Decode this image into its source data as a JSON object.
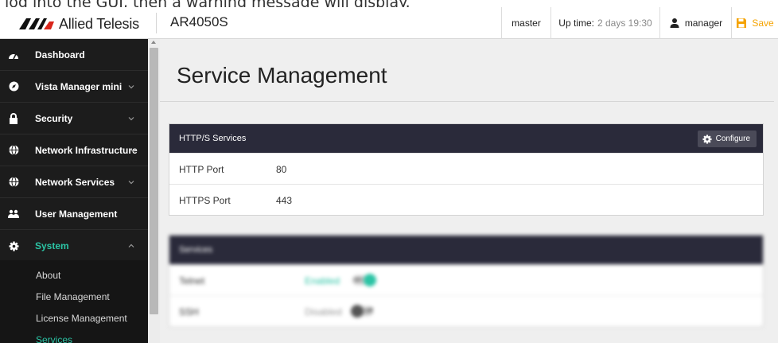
{
  "caption": {
    "text": "log into the GUI, then a warning message will display."
  },
  "header": {
    "brand": "Allied Telesis",
    "model": "AR4050S",
    "master": "master",
    "uptime_label": "Up time:",
    "uptime_value": "2 days 19:30",
    "user": "manager",
    "save": "Save",
    "save_color": "#f5a300"
  },
  "sidebar": {
    "items": [
      {
        "label": "Dashboard",
        "icon": "dashboard-icon"
      },
      {
        "label": "Vista Manager mini",
        "icon": "compass-icon"
      },
      {
        "label": "Security",
        "icon": "lock-icon"
      },
      {
        "label": "Network Infrastructure",
        "icon": "globe-icon"
      },
      {
        "label": "Network Services",
        "icon": "globe-icon"
      },
      {
        "label": "User Management",
        "icon": "users-icon"
      },
      {
        "label": "System",
        "icon": "gear-icon"
      }
    ],
    "submenu": [
      "About",
      "File Management",
      "License Management",
      "Services"
    ],
    "accent_color": "#2bc4a5"
  },
  "main": {
    "title": "Service Management",
    "https_card": {
      "title": "HTTP/S Services",
      "configure": "Configure",
      "rows": [
        {
          "key": "HTTP Port",
          "value": "80"
        },
        {
          "key": "HTTPS Port",
          "value": "443"
        }
      ]
    },
    "services_card": {
      "title": "Services",
      "rows": [
        {
          "key": "Telnet",
          "value": "Enabled",
          "extra": "on"
        },
        {
          "key": "SSH",
          "value": "Disabled",
          "extra": "off"
        }
      ]
    }
  }
}
